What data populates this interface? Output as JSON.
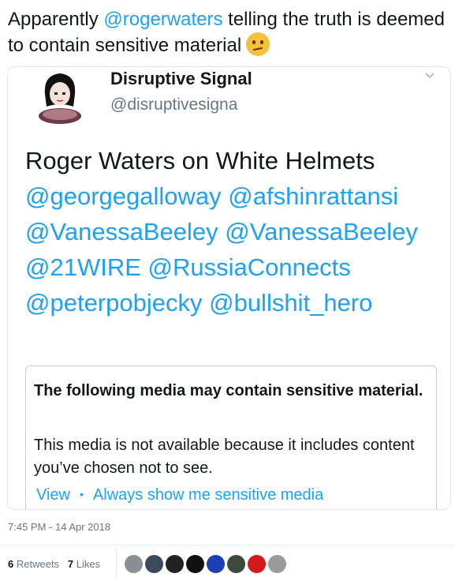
{
  "tweet": {
    "text_before": "Apparently ",
    "mention": "@rogerwaters",
    "text_after": " telling the truth is deemed to contain sensitive material",
    "emoji_icon": "thinking-face-icon"
  },
  "quoted": {
    "name": "Disruptive Signal",
    "handle": "@disruptivesigna",
    "body_text": "Roger Waters on White Helmets",
    "mentions": [
      "@georgegalloway",
      "@afshinrattansi",
      "@VanessaBeeley",
      "@VanessaBeeley",
      "@21WIRE",
      "@RussiaConnects",
      "@peterpobjecky",
      "@bullshit_hero"
    ],
    "sensitive": {
      "title": "The following media may contain sensitive material.",
      "description": "This media is not available because it includes content you’ve chosen not to see.",
      "view_label": "View",
      "always_show_label": "Always show me sensitive media"
    }
  },
  "meta": {
    "timestamp": "7:45 PM - 14 Apr 2018",
    "retweets_count": "6",
    "retweets_label": "Retweets",
    "likes_count": "7",
    "likes_label": "Likes"
  },
  "likers": [
    {
      "icon": "liker-avatar-1",
      "color": "#8a8f94"
    },
    {
      "icon": "liker-avatar-2",
      "color": "#3a4a5a"
    },
    {
      "icon": "liker-avatar-3",
      "color": "#222222"
    },
    {
      "icon": "liker-avatar-4",
      "color": "#111111"
    },
    {
      "icon": "liker-avatar-5",
      "color": "#1d3fb5"
    },
    {
      "icon": "liker-avatar-6",
      "color": "#3b4a3b"
    },
    {
      "icon": "liker-avatar-7",
      "color": "#d11b1b"
    },
    {
      "icon": "liker-avatar-8",
      "color": "#9a9a9a"
    }
  ],
  "colors": {
    "link": "#1da1f2",
    "text": "#14171a",
    "muted": "#657786",
    "border": "#e1e8ed"
  }
}
